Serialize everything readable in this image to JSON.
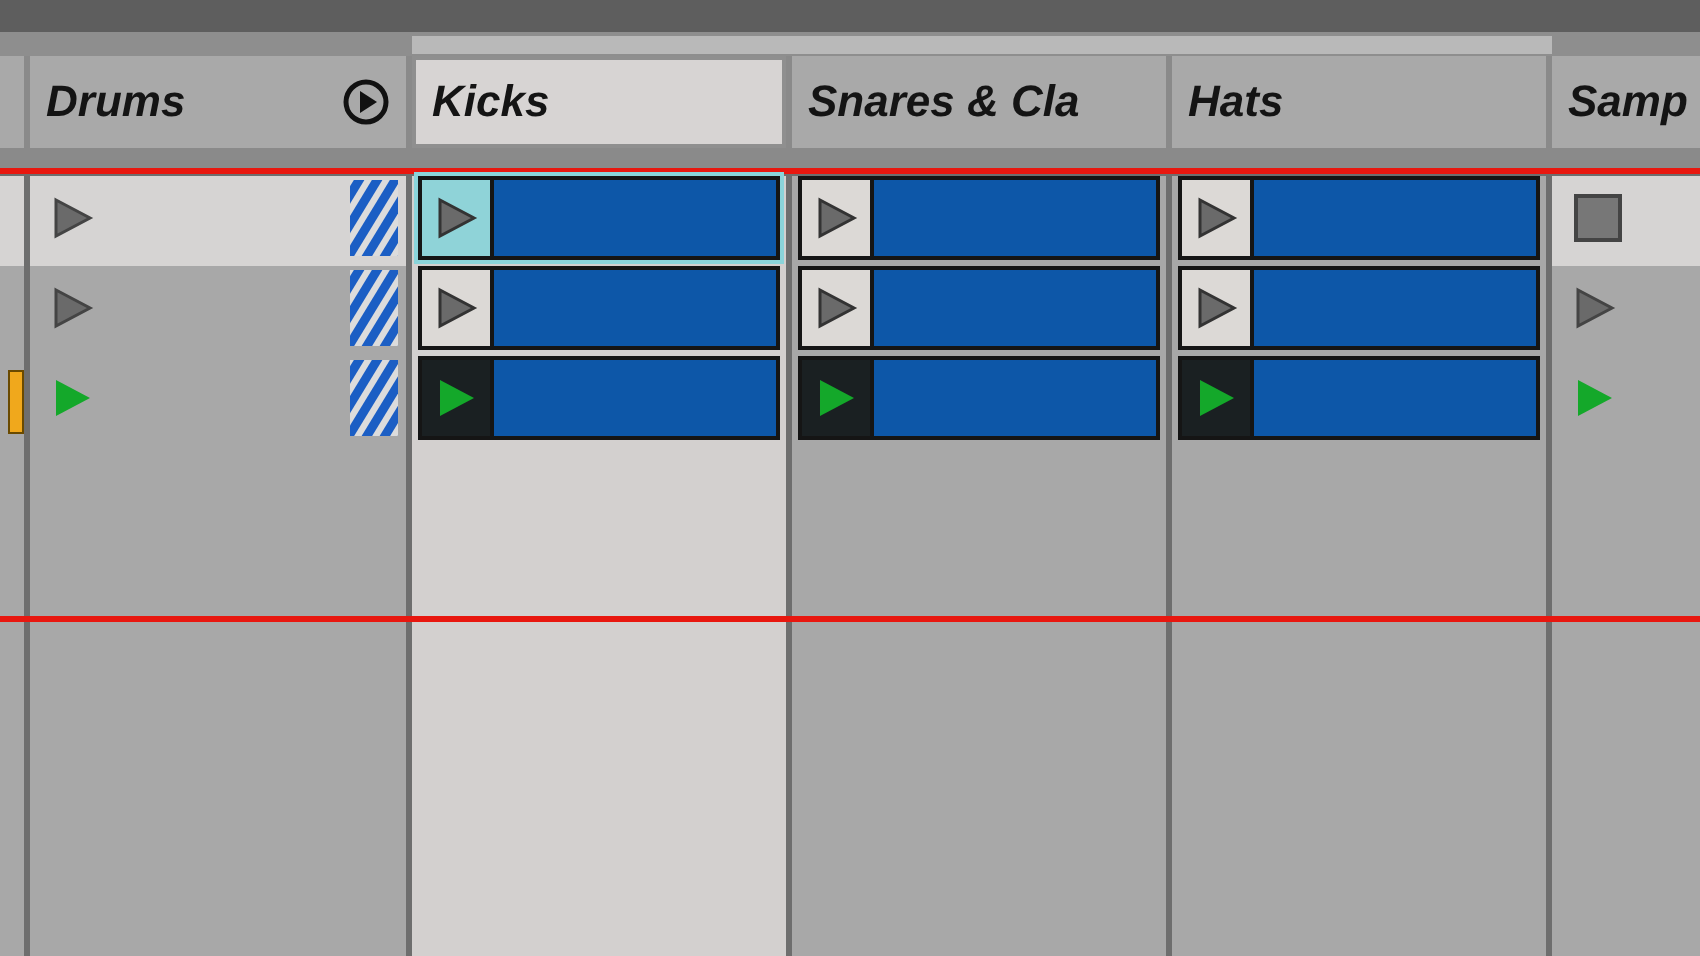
{
  "tracks": [
    {
      "name": "Drums",
      "kind": "group",
      "selected": false,
      "grouped": false
    },
    {
      "name": "Kicks",
      "kind": "clip",
      "selected": true,
      "grouped": true
    },
    {
      "name": "Snares & Cla",
      "kind": "clip",
      "selected": false,
      "grouped": true
    },
    {
      "name": "Hats",
      "kind": "clip",
      "selected": false,
      "grouped": true
    },
    {
      "name": "Samp",
      "kind": "audio",
      "selected": false,
      "grouped": false
    }
  ],
  "scenes": [
    {
      "selected": true,
      "marker": false,
      "slots": [
        {
          "kind": "group",
          "playing": false
        },
        {
          "kind": "clip",
          "playing": false,
          "selected": true
        },
        {
          "kind": "clip",
          "playing": false,
          "selected": false
        },
        {
          "kind": "clip",
          "playing": false,
          "selected": false
        },
        {
          "kind": "stop"
        }
      ]
    },
    {
      "selected": false,
      "marker": false,
      "slots": [
        {
          "kind": "group",
          "playing": false
        },
        {
          "kind": "clip",
          "playing": false,
          "selected": false
        },
        {
          "kind": "clip",
          "playing": false,
          "selected": false
        },
        {
          "kind": "clip",
          "playing": false,
          "selected": false
        },
        {
          "kind": "empty",
          "playing": false
        }
      ]
    },
    {
      "selected": false,
      "marker": true,
      "slots": [
        {
          "kind": "group",
          "playing": true
        },
        {
          "kind": "clip",
          "playing": true,
          "selected": false
        },
        {
          "kind": "clip",
          "playing": true,
          "selected": false
        },
        {
          "kind": "clip",
          "playing": true,
          "selected": false
        },
        {
          "kind": "empty",
          "playing": true
        }
      ]
    }
  ]
}
